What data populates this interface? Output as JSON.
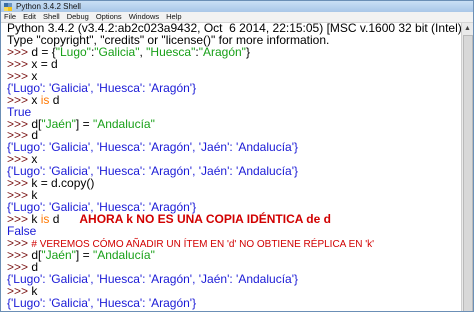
{
  "window": {
    "title": "Python 3.4.2 Shell"
  },
  "menu": [
    "File",
    "Edit",
    "Shell",
    "Debug",
    "Options",
    "Windows",
    "Help"
  ],
  "lines": [
    [
      {
        "t": "Python 3.4.2 (v3.4.2:ab2c023a9432, Oct  6 2014, 22:15:05) [MSC v.1600 32 bit (Intel)] on win32",
        "c": "code"
      }
    ],
    [
      {
        "t": "Type \"copyright\", \"credits\" or \"license()\" for more information.",
        "c": "code"
      }
    ],
    [
      {
        "t": ">>> ",
        "c": "prompt"
      },
      {
        "t": "d = {",
        "c": "code"
      },
      {
        "t": "\"Lugo\"",
        "c": "str"
      },
      {
        "t": ":",
        "c": "code"
      },
      {
        "t": "\"Galicia\"",
        "c": "str"
      },
      {
        "t": ", ",
        "c": "code"
      },
      {
        "t": "\"Huesca\"",
        "c": "str"
      },
      {
        "t": ":",
        "c": "code"
      },
      {
        "t": "\"Aragón\"",
        "c": "str"
      },
      {
        "t": "}",
        "c": "code"
      }
    ],
    [
      {
        "t": ">>> ",
        "c": "prompt"
      },
      {
        "t": "x = d",
        "c": "code"
      }
    ],
    [
      {
        "t": ">>> ",
        "c": "prompt"
      },
      {
        "t": "x",
        "c": "code"
      }
    ],
    [
      {
        "t": "{'Lugo': 'Galicia', 'Huesca': 'Aragón'}",
        "c": "out"
      }
    ],
    [
      {
        "t": ">>> ",
        "c": "prompt"
      },
      {
        "t": "x ",
        "c": "code"
      },
      {
        "t": "is",
        "c": "kw"
      },
      {
        "t": " d",
        "c": "code"
      }
    ],
    [
      {
        "t": "True",
        "c": "out"
      }
    ],
    [
      {
        "t": ">>> ",
        "c": "prompt"
      },
      {
        "t": "d[",
        "c": "code"
      },
      {
        "t": "\"Jaén\"",
        "c": "str"
      },
      {
        "t": "] = ",
        "c": "code"
      },
      {
        "t": "\"Andalucía\"",
        "c": "str"
      }
    ],
    [
      {
        "t": ">>> ",
        "c": "prompt"
      },
      {
        "t": "d",
        "c": "code"
      }
    ],
    [
      {
        "t": "{'Lugo': 'Galicia', 'Huesca': 'Aragón', 'Jaén': 'Andalucía'}",
        "c": "out"
      }
    ],
    [
      {
        "t": ">>> ",
        "c": "prompt"
      },
      {
        "t": "x",
        "c": "code"
      }
    ],
    [
      {
        "t": "{'Lugo': 'Galicia', 'Huesca': 'Aragón', 'Jaén': 'Andalucía'}",
        "c": "out"
      }
    ],
    [
      {
        "t": ">>> ",
        "c": "prompt"
      },
      {
        "t": "k = d.copy()",
        "c": "code"
      }
    ],
    [
      {
        "t": ">>> ",
        "c": "prompt"
      },
      {
        "t": "k",
        "c": "code"
      }
    ],
    [
      {
        "t": "{'Lugo': 'Galicia', 'Huesca': 'Aragón'}",
        "c": "out"
      }
    ],
    [
      {
        "t": ">>> ",
        "c": "prompt"
      },
      {
        "t": "k ",
        "c": "code"
      },
      {
        "t": "is",
        "c": "kw"
      },
      {
        "t": " d      ",
        "c": "code"
      },
      {
        "t": "AHORA k NO ES UNA COPIA IDÉNTICA de d",
        "c": "note"
      }
    ],
    [
      {
        "t": "False",
        "c": "out"
      }
    ],
    [
      {
        "t": ">>> ",
        "c": "prompt"
      },
      {
        "t": "# VEREMOS CÓMO AÑADIR UN ÍTEM EN 'd' NO OBTIENE RÉPLICA EN 'k'",
        "c": "note-small"
      }
    ],
    [
      {
        "t": ">>> ",
        "c": "prompt"
      },
      {
        "t": "d[",
        "c": "code"
      },
      {
        "t": "\"Jaén\"",
        "c": "str"
      },
      {
        "t": "] = ",
        "c": "code"
      },
      {
        "t": "\"Andalucía\"",
        "c": "str"
      }
    ],
    [
      {
        "t": ">>> ",
        "c": "prompt"
      },
      {
        "t": "d",
        "c": "code"
      }
    ],
    [
      {
        "t": "{'Lugo': 'Galicia', 'Huesca': 'Aragón', 'Jaén': 'Andalucía'}",
        "c": "out"
      }
    ],
    [
      {
        "t": ">>> ",
        "c": "prompt"
      },
      {
        "t": "k",
        "c": "code"
      }
    ],
    [
      {
        "t": "{'Lugo': 'Galicia', 'Huesca': 'Aragón'}",
        "c": "out"
      }
    ],
    [
      {
        "t": ">>> ",
        "c": "prompt"
      }
    ]
  ]
}
